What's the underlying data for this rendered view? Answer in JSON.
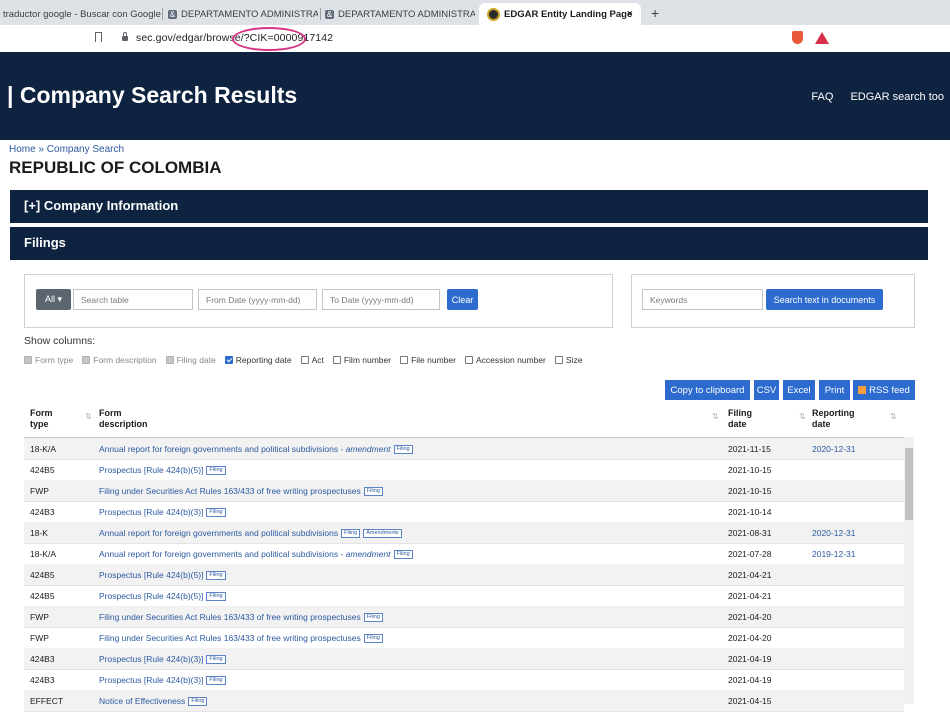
{
  "browser": {
    "tabs": [
      {
        "title": "traductor google - Buscar con Google"
      },
      {
        "title": "DEPARTAMENTO ADMINISTRATIVO D"
      },
      {
        "title": "DEPARTAMENTO ADMINISTRATIVO D"
      },
      {
        "title": "EDGAR Entity Landing Page"
      }
    ],
    "close_glyph": "×",
    "new_tab_glyph": "+",
    "url": "sec.gov/edgar/browse/?CIK=0000917142"
  },
  "header": {
    "title": "Company Search Results",
    "nav": [
      "FAQ",
      "EDGAR search too"
    ]
  },
  "breadcrumb": "Home » Company Search",
  "entity_name": "REPUBLIC OF COLOMBIA",
  "company_info_label": "[+] Company Information",
  "filings_label": "Filings",
  "filters": {
    "all_label": "All ▾",
    "search_placeholder": "Search table",
    "from_placeholder": "From Date (yyyy-mm-dd)",
    "to_placeholder": "To Date (yyyy-mm-dd)",
    "clear_label": "Clear",
    "keywords_placeholder": "Keywords",
    "search_docs_label": "Search text in documents"
  },
  "show_columns_label": "Show columns:",
  "columns": [
    {
      "label": "Form type",
      "state": "disabled"
    },
    {
      "label": "Form description",
      "state": "disabled"
    },
    {
      "label": "Filing date",
      "state": "disabled"
    },
    {
      "label": "Reporting date",
      "state": "checked"
    },
    {
      "label": "Act",
      "state": "unchecked"
    },
    {
      "label": "Film number",
      "state": "unchecked"
    },
    {
      "label": "File number",
      "state": "unchecked"
    },
    {
      "label": "Accession number",
      "state": "unchecked"
    },
    {
      "label": "Size",
      "state": "unchecked"
    }
  ],
  "table_buttons": [
    "Copy to clipboard",
    "CSV",
    "Excel",
    "Print",
    "RSS feed"
  ],
  "table_headers": {
    "form_type": "Form type",
    "form_description": "Form description",
    "filing_date": "Filing date",
    "reporting_date": "Reporting date"
  },
  "rows": [
    {
      "type": "18-K/A",
      "desc": "Annual report for foreign governments and political subdivisions - ",
      "desc_em": "amendment",
      "tags": [
        "Filing"
      ],
      "filing": "2021-11-15",
      "reporting": "2020-12-31"
    },
    {
      "type": "424B5",
      "desc": "Prospectus [Rule 424(b)(5)]",
      "desc_em": "",
      "tags": [
        "Filing"
      ],
      "filing": "2021-10-15",
      "reporting": ""
    },
    {
      "type": "FWP",
      "desc": "Filing under Securities Act Rules 163/433 of free writing prospectuses",
      "desc_em": "",
      "tags": [
        "Filing"
      ],
      "filing": "2021-10-15",
      "reporting": ""
    },
    {
      "type": "424B3",
      "desc": "Prospectus [Rule 424(b)(3)]",
      "desc_em": "",
      "tags": [
        "Filing"
      ],
      "filing": "2021-10-14",
      "reporting": ""
    },
    {
      "type": "18-K",
      "desc": "Annual report for foreign governments and political subdivisions",
      "desc_em": "",
      "tags": [
        "Filing",
        "Amendments"
      ],
      "filing": "2021-08-31",
      "reporting": "2020-12-31"
    },
    {
      "type": "18-K/A",
      "desc": "Annual report for foreign governments and political subdivisions - ",
      "desc_em": "amendment",
      "tags": [
        "Filing"
      ],
      "filing": "2021-07-28",
      "reporting": "2019-12-31"
    },
    {
      "type": "424B5",
      "desc": "Prospectus [Rule 424(b)(5)]",
      "desc_em": "",
      "tags": [
        "Filing"
      ],
      "filing": "2021-04-21",
      "reporting": ""
    },
    {
      "type": "424B5",
      "desc": "Prospectus [Rule 424(b)(5)]",
      "desc_em": "",
      "tags": [
        "Filing"
      ],
      "filing": "2021-04-21",
      "reporting": ""
    },
    {
      "type": "FWP",
      "desc": "Filing under Securities Act Rules 163/433 of free writing prospectuses",
      "desc_em": "",
      "tags": [
        "Filing"
      ],
      "filing": "2021-04-20",
      "reporting": ""
    },
    {
      "type": "FWP",
      "desc": "Filing under Securities Act Rules 163/433 of free writing prospectuses",
      "desc_em": "",
      "tags": [
        "Filing"
      ],
      "filing": "2021-04-20",
      "reporting": ""
    },
    {
      "type": "424B3",
      "desc": "Prospectus [Rule 424(b)(3)]",
      "desc_em": "",
      "tags": [
        "Filing"
      ],
      "filing": "2021-04-19",
      "reporting": ""
    },
    {
      "type": "424B3",
      "desc": "Prospectus [Rule 424(b)(3)]",
      "desc_em": "",
      "tags": [
        "Filing"
      ],
      "filing": "2021-04-19",
      "reporting": ""
    },
    {
      "type": "EFFECT",
      "desc": "Notice of Effectiveness",
      "desc_em": "",
      "tags": [
        "Filing"
      ],
      "filing": "2021-04-15",
      "reporting": ""
    }
  ]
}
